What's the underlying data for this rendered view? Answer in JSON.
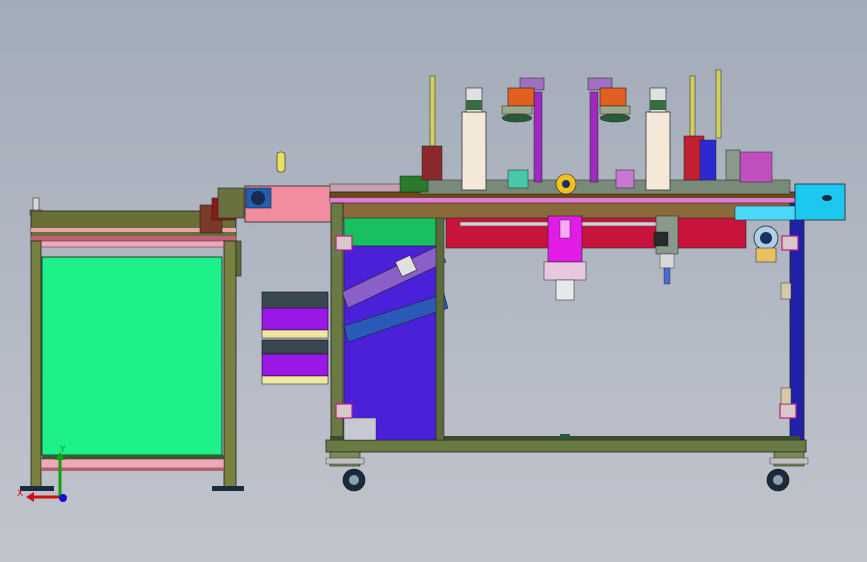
{
  "triad": {
    "x_label": "X",
    "y_label": "Y"
  },
  "colors": {
    "background_top": "#a2abb9",
    "background_bottom": "#c1c4cc",
    "frame_olive": "#5f6a3a",
    "panel_green": "#1ef089",
    "table_top_brown": "#6a4a1a",
    "belt_pink": "#f08ea0",
    "crimson_plate": "#c8143c",
    "purple_block": "#4a20d8",
    "magenta_unit": "#e21ce6",
    "drawer_purple": "#9a18e6",
    "drawer_yellow": "#f0e8a0",
    "blue_leg": "#2020a8",
    "cyan_box": "#1cc8f0",
    "axis_x": "#d01010",
    "axis_y": "#10a010",
    "axis_z": "#1010d0"
  }
}
